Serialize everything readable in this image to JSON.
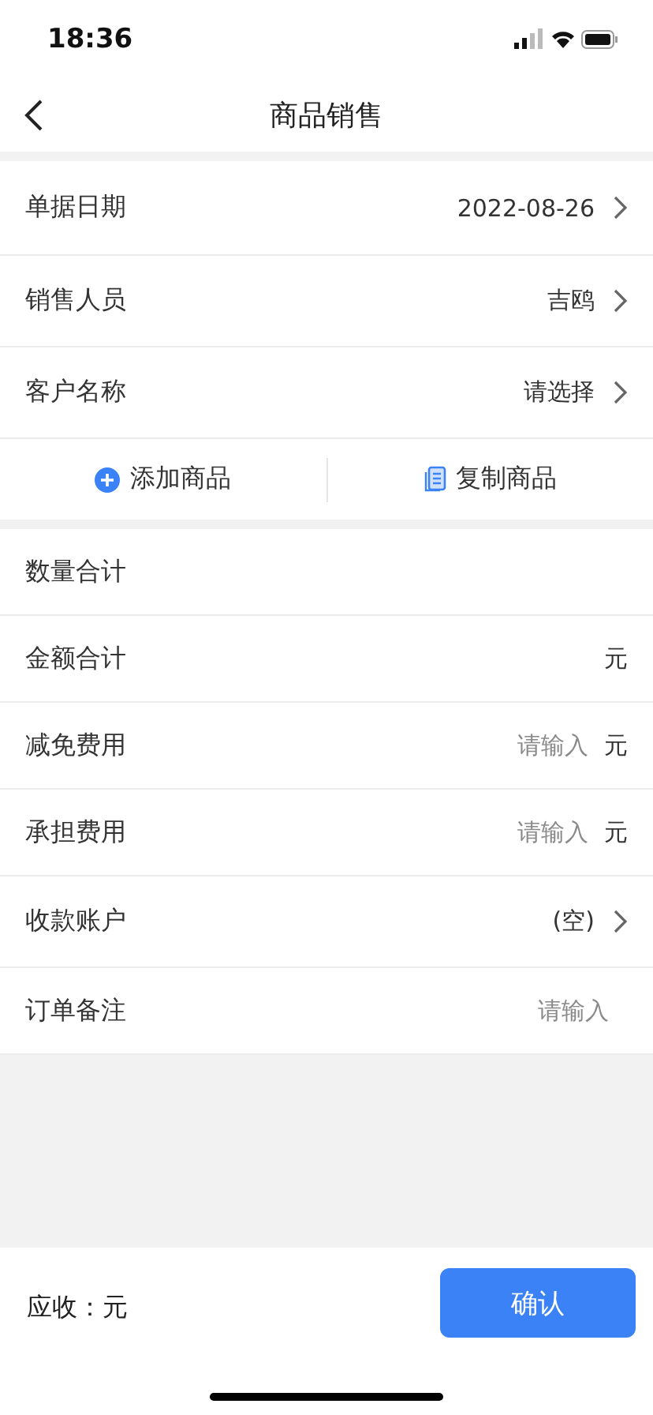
{
  "status_bar": {
    "time": "18:36"
  },
  "nav": {
    "title": "商品销售"
  },
  "header_rows": [
    {
      "label": "单据日期",
      "value": "2022-08-26",
      "chevron": true
    },
    {
      "label": "销售人员",
      "value": "吉鸥",
      "chevron": true
    },
    {
      "label": "客户名称",
      "value": "请选择",
      "chevron": true
    }
  ],
  "actions": [
    {
      "kind": "add",
      "label": "添加商品"
    },
    {
      "kind": "copy",
      "label": "复制商品"
    }
  ],
  "summary_rows": [
    {
      "kind": "text",
      "label": "数量合计"
    },
    {
      "kind": "text",
      "label": "金额合计",
      "unit": "元"
    },
    {
      "kind": "input",
      "label": "减免费用",
      "placeholder": "请输入",
      "unit": "元"
    },
    {
      "kind": "input",
      "label": "承担费用",
      "placeholder": "请输入",
      "unit": "元"
    },
    {
      "kind": "select",
      "label": "收款账户",
      "value": "(空)",
      "chevron": true
    },
    {
      "kind": "input",
      "label": "订单备注",
      "placeholder": "请输入"
    }
  ],
  "footer": {
    "receivable": "应收：元",
    "confirm": "确认"
  }
}
